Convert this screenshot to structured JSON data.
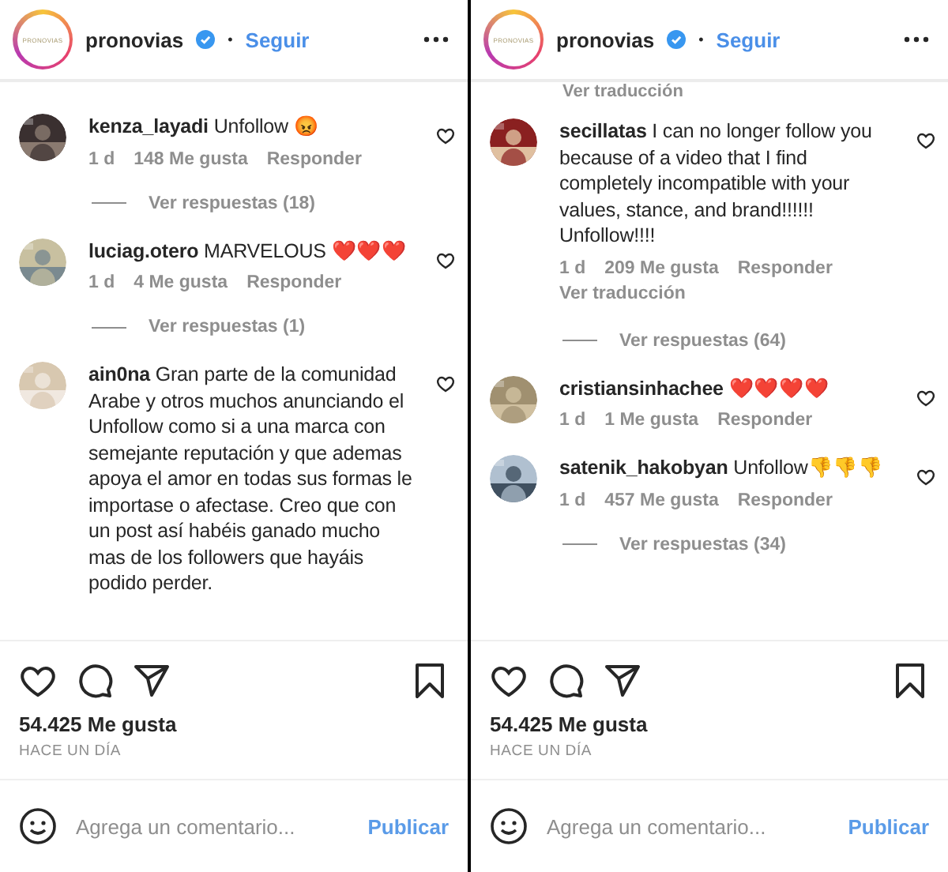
{
  "panels": [
    {
      "header": {
        "account": "pronovias",
        "separator": "•",
        "follow": "Seguir",
        "logo_text": "PRONOVIAS"
      },
      "comments": [
        {
          "user": "kenza_layadi",
          "text": "Unfollow 😡",
          "time": "1 d",
          "likes": "148 Me gusta",
          "reply": "Responder",
          "replies": "Ver respuestas (18)"
        },
        {
          "user": "luciag.otero",
          "text": "MARVELOUS ❤️❤️❤️",
          "time": "1 d",
          "likes": "4 Me gusta",
          "reply": "Responder",
          "replies": "Ver respuestas (1)"
        },
        {
          "user": "ain0na",
          "text": "Gran parte de la comunidad Arabe y otros muchos anunciando el Unfollow como si a una marca con semejante reputación y que ademas apoya el amor en todas sus formas le importase o afectase. Creo que con un post así habéis ganado mucho mas de los followers que hayáis podido perder."
        }
      ],
      "likes": "54.425 Me gusta",
      "time": "HACE UN DÍA",
      "comment_placeholder": "Agrega un comentario...",
      "publish": "Publicar"
    },
    {
      "header": {
        "account": "pronovias",
        "separator": "•",
        "follow": "Seguir",
        "logo_text": "PRONOVIAS"
      },
      "top_fragment": "Ver traducción",
      "comments": [
        {
          "user": "secillatas",
          "text": "I can no longer follow you because of a video that I find completely incompatible with your values, stance, and brand!!!!!! Unfollow!!!!",
          "time": "1 d",
          "likes": "209 Me gusta",
          "reply": "Responder",
          "translate": "Ver traducción",
          "replies": "Ver respuestas (64)"
        },
        {
          "user": "cristiansinhachee",
          "text": "❤️❤️❤️❤️",
          "time": "1 d",
          "likes": "1 Me gusta",
          "reply": "Responder"
        },
        {
          "user": "satenik_hakobyan",
          "text": "Unfollow👎👎👎",
          "time": "1 d",
          "likes": "457 Me gusta",
          "reply": "Responder",
          "replies": "Ver respuestas (34)"
        }
      ],
      "likes": "54.425 Me gusta",
      "time": "HACE UN DÍA",
      "comment_placeholder": "Agrega un comentario...",
      "publish": "Publicar"
    }
  ]
}
